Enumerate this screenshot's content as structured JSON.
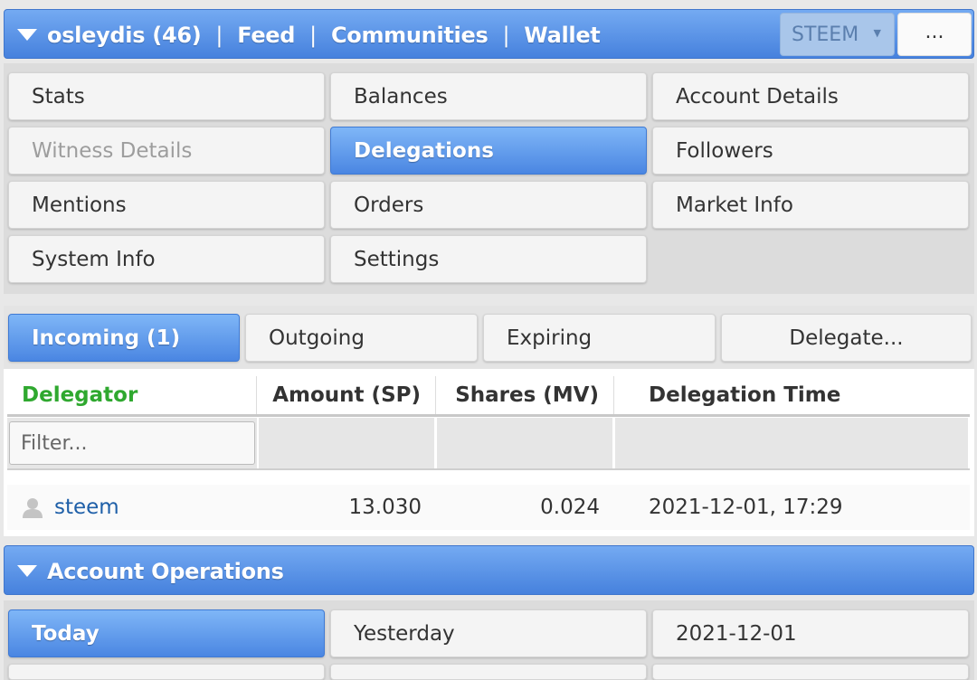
{
  "header": {
    "username": "osleydis (46)",
    "separator": "|",
    "feed": "Feed",
    "communities": "Communities",
    "wallet": "Wallet",
    "token": "STEEM",
    "token_caret": "▼",
    "more": "..."
  },
  "menu": {
    "stats": "Stats",
    "balances": "Balances",
    "account_details": "Account Details",
    "witness_details": "Witness Details",
    "delegations": "Delegations",
    "followers": "Followers",
    "mentions": "Mentions",
    "orders": "Orders",
    "market_info": "Market Info",
    "system_info": "System Info",
    "settings": "Settings"
  },
  "delegation_tabs": {
    "incoming": "Incoming (1)",
    "outgoing": "Outgoing",
    "expiring": "Expiring",
    "delegate": "Delegate..."
  },
  "table": {
    "headers": {
      "delegator": "Delegator",
      "amount": "Amount (SP)",
      "shares": "Shares (MV)",
      "time": "Delegation Time"
    },
    "filter_placeholder": "Filter...",
    "rows": [
      {
        "delegator": "steem",
        "amount": "13.030",
        "shares": "0.024",
        "time": "2021-12-01, 17:29"
      }
    ]
  },
  "operations": {
    "title": "Account Operations",
    "today": "Today",
    "yesterday": "Yesterday",
    "date": "2021-12-01"
  },
  "colors": {
    "accent": "#4a86e2",
    "delegator_header": "#2fa82f",
    "link": "#1e5fa8"
  }
}
